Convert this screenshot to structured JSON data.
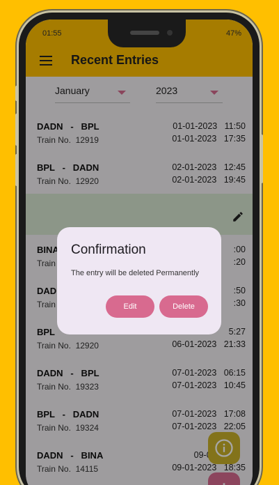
{
  "status_bar": {
    "time": "01:55",
    "battery": "47%"
  },
  "app_bar": {
    "title": "Recent Entries"
  },
  "filters": {
    "month": "January",
    "year": "2023"
  },
  "entries": [
    {
      "route": "DADN   -   BPL",
      "train": "Train No.  12919",
      "dep": "01-01-2023   11:50",
      "arr": "01-01-2023   17:35"
    },
    {
      "route": "BPL   -   DADN",
      "train": "Train No.  12920",
      "dep": "02-01-2023   12:45",
      "arr": "02-01-2023   19:45"
    },
    {
      "route": "",
      "train": "",
      "dep": "",
      "arr": ""
    },
    {
      "route": "BINA",
      "train": "Train",
      "dep": ":00",
      "arr": ":20"
    },
    {
      "route": "DAD",
      "train": "Train",
      "dep": ":50",
      "arr": ":30"
    },
    {
      "route": "BPL",
      "train": "Train No.  12920",
      "dep": "5:27",
      "arr": "06-01-2023   21:33"
    },
    {
      "route": "DADN   -   BPL",
      "train": "Train No.  19323",
      "dep": "07-01-2023   06:15",
      "arr": "07-01-2023   10:45"
    },
    {
      "route": "BPL   -   DADN",
      "train": "Train No.  19324",
      "dep": "07-01-2023   17:08",
      "arr": "07-01-2023   22:05"
    },
    {
      "route": "DADN   -   BINA",
      "train": "Train No.  14115",
      "dep": "09-01-2023   ",
      "arr": "09-01-2023   18:35"
    }
  ],
  "dialog": {
    "title": "Confirmation",
    "message": "The entry will be deleted Permanently",
    "edit_label": "Edit",
    "delete_label": "Delete"
  },
  "icons": {
    "menu": "hamburger-menu-icon",
    "dropdown": "dropdown-caret-icon",
    "edit": "pencil-icon",
    "info": "info-icon",
    "add": "plus-icon"
  },
  "colors": {
    "background": "#FFBF00",
    "accent": "#D86A8F",
    "dialog": "#EFE7F3",
    "highlight": "#D8E6D2"
  }
}
